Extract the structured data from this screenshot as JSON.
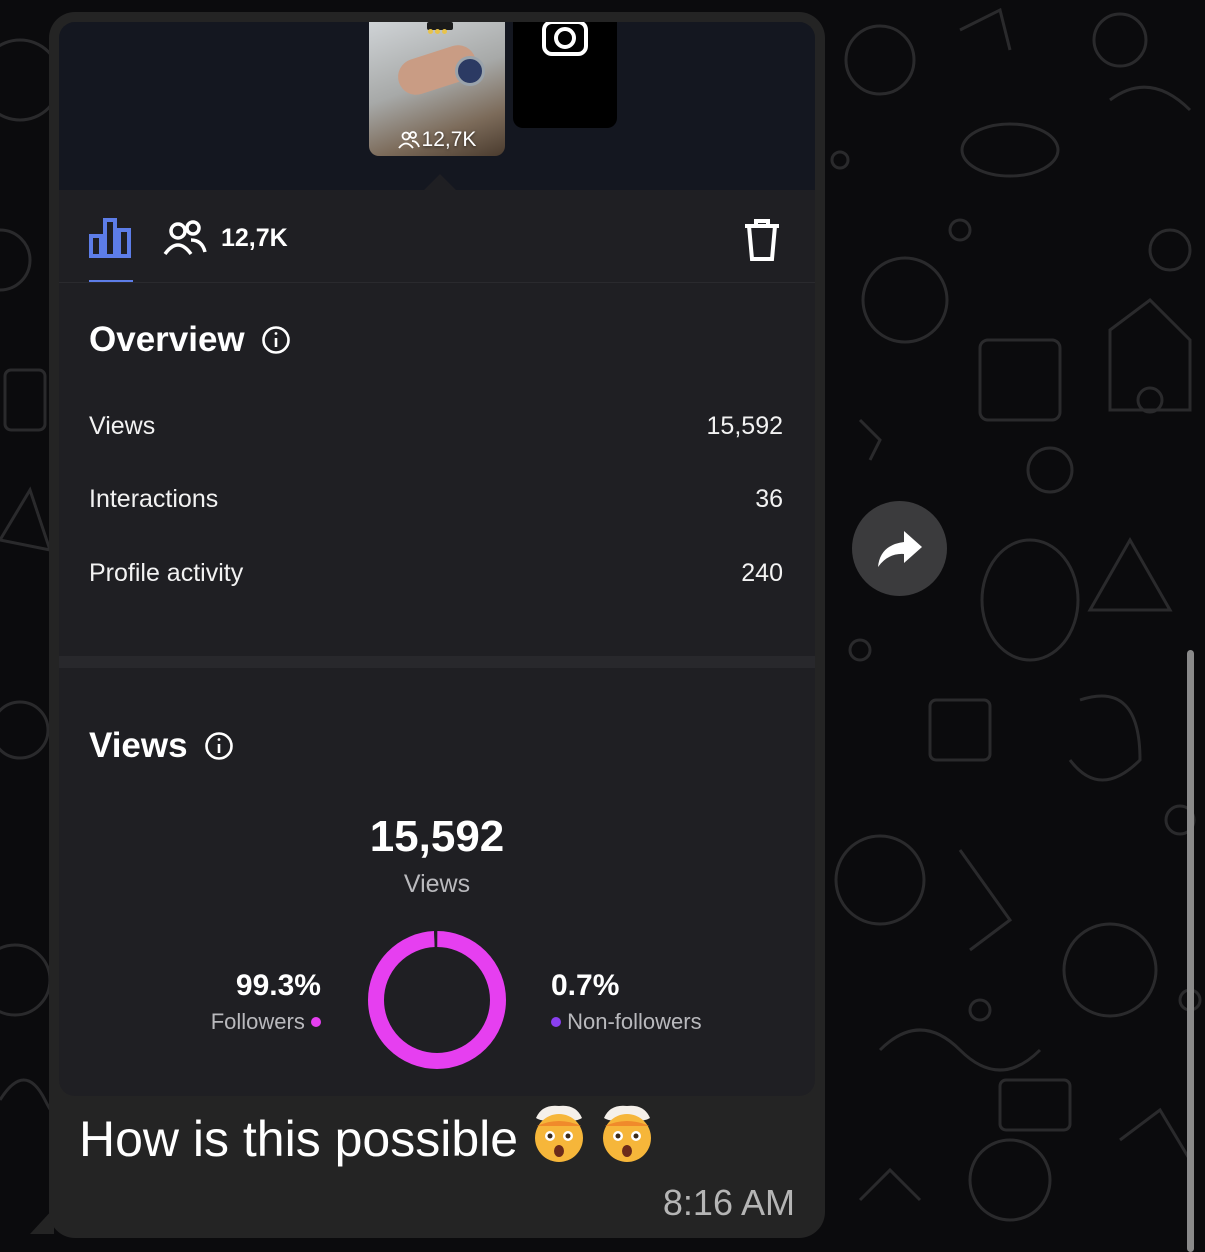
{
  "story": {
    "viewer_count": "12,7K"
  },
  "tabs": {
    "viewers_count": "12,7K"
  },
  "overview": {
    "title": "Overview",
    "rows": [
      {
        "label": "Views",
        "value": "15,592"
      },
      {
        "label": "Interactions",
        "value": "36"
      },
      {
        "label": "Profile activity",
        "value": "240"
      }
    ]
  },
  "views": {
    "title": "Views",
    "total": "15,592",
    "total_label": "Views",
    "followers": {
      "percent": "99.3%",
      "label": "Followers",
      "fraction": 0.993
    },
    "non_followers": {
      "percent": "0.7%",
      "label": "Non-followers",
      "fraction": 0.007
    }
  },
  "message": {
    "caption": "How is this possible",
    "time": "8:16 AM"
  },
  "colors": {
    "followers": "#e63ff0",
    "non_followers": "#8a3ff0",
    "accent": "#5d7de8"
  }
}
